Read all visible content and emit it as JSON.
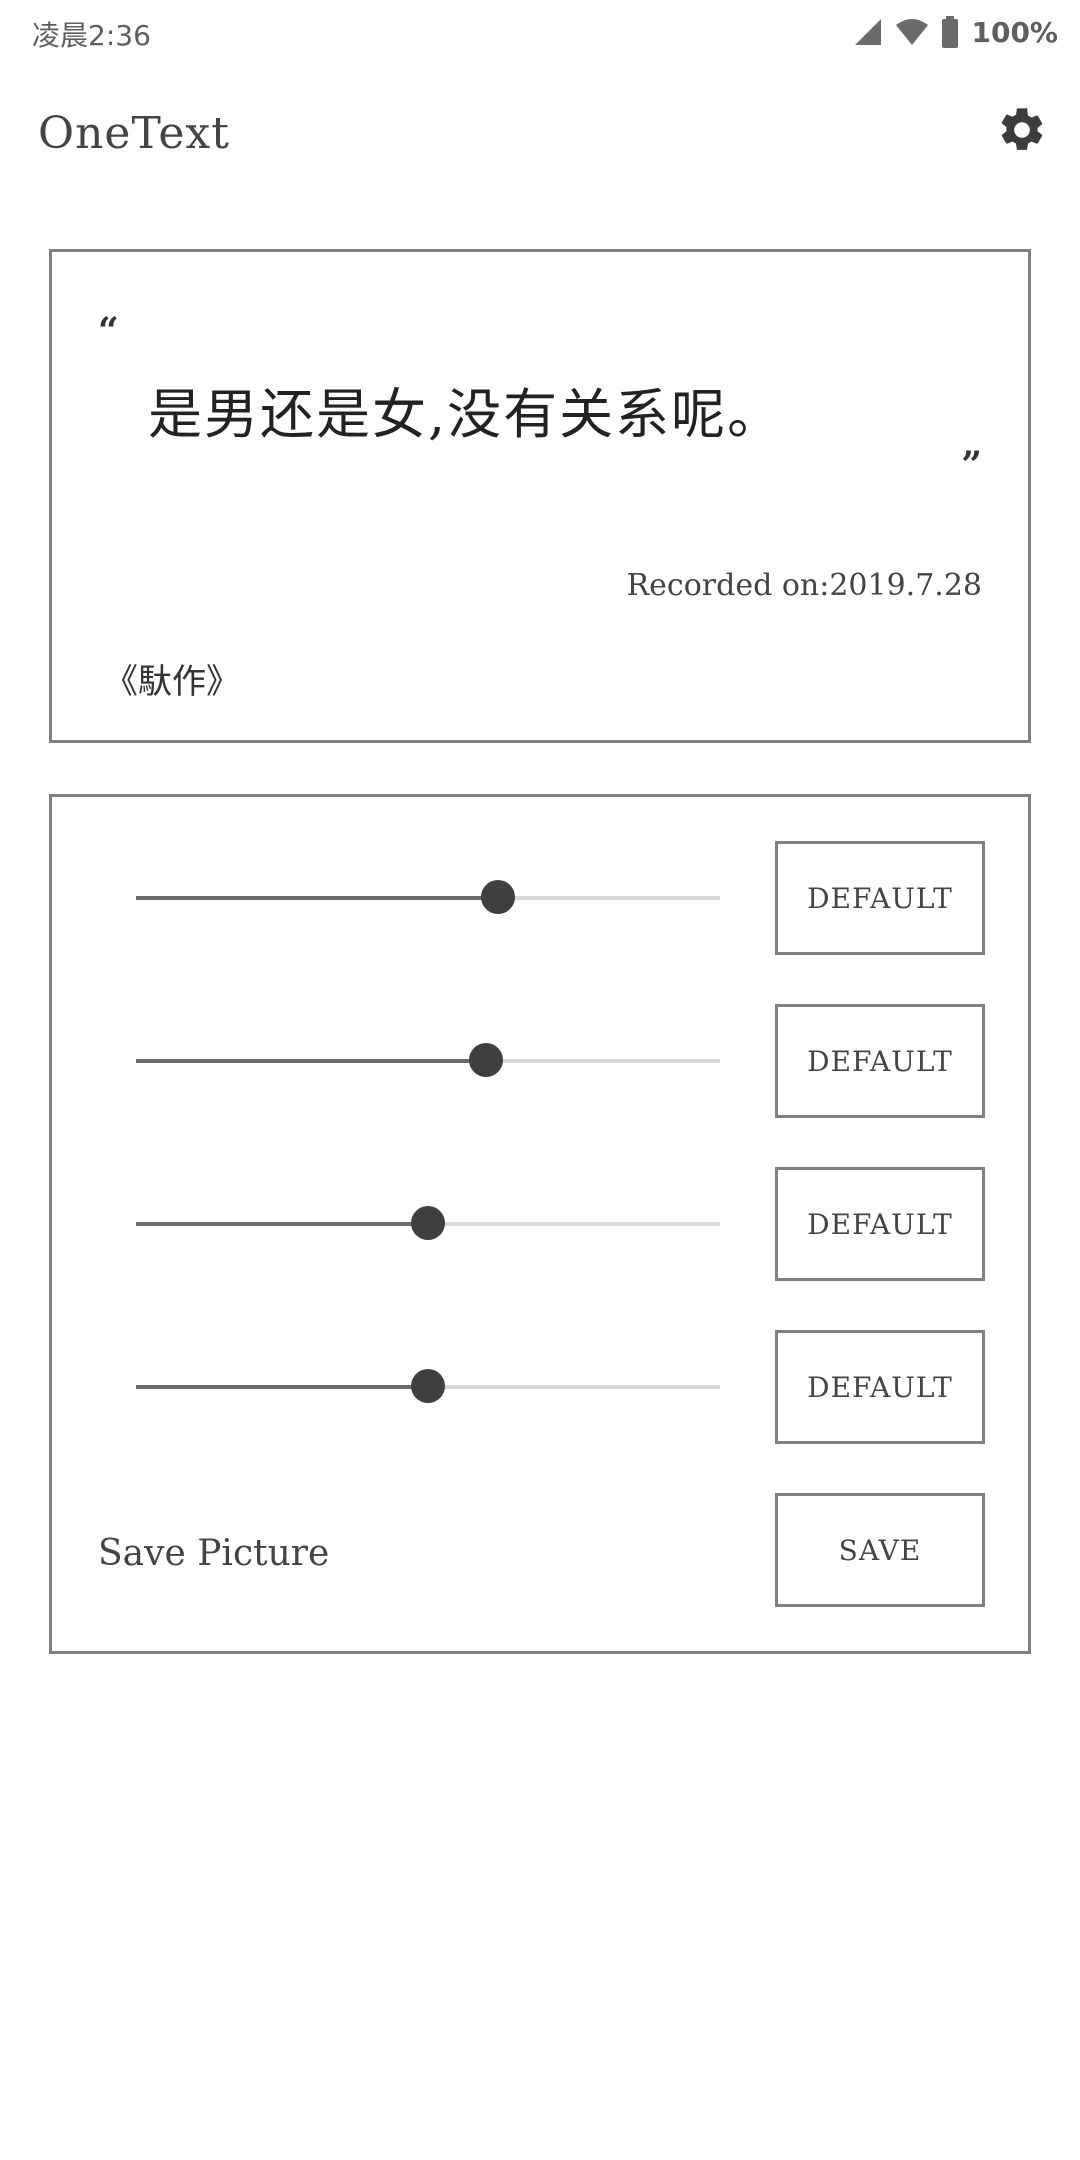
{
  "status_bar": {
    "time": "凌晨2:36",
    "battery": "100%"
  },
  "app_bar": {
    "title": "OneText",
    "settings_icon": "gear-icon"
  },
  "quote_card": {
    "open_mark": "“",
    "text": "是男还是女,没有关系呢。",
    "close_mark": "”",
    "recorded": "Recorded on:2019.7.28",
    "source": "《馱作》"
  },
  "controls": {
    "sliders": [
      {
        "value": 0.62,
        "button_label": "DEFAULT"
      },
      {
        "value": 0.6,
        "button_label": "DEFAULT"
      },
      {
        "value": 0.5,
        "button_label": "DEFAULT"
      },
      {
        "value": 0.5,
        "button_label": "DEFAULT"
      }
    ],
    "save_label": "Save Picture",
    "save_button": "SAVE"
  },
  "colors": {
    "border": "#808080",
    "slider_fill": "#6b6b6b",
    "slider_track": "#d9d9d9",
    "thumb": "#3f3f3f"
  }
}
